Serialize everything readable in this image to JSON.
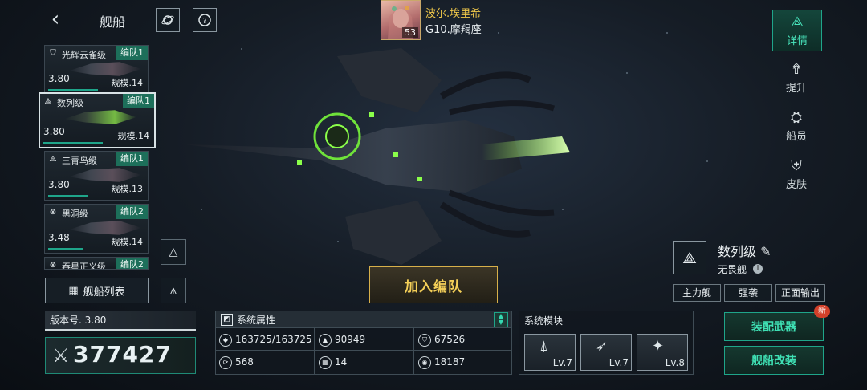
{
  "header": {
    "back_icon": "back-arrow-icon",
    "title": "舰船"
  },
  "commander": {
    "name": "波尔.埃里希",
    "rank": "G10.摩羯座",
    "level": "53"
  },
  "ship_list": [
    {
      "name": "光辉云雀级",
      "fleet": "编队1",
      "version": "3.80",
      "scale": "规模.14",
      "selected": false,
      "progress": 0.62
    },
    {
      "name": "数列级",
      "fleet": "编队1",
      "version": "3.80",
      "scale": "规模.14",
      "selected": true,
      "progress": 0.55
    },
    {
      "name": "三青鸟级",
      "fleet": "编队1",
      "version": "3.80",
      "scale": "规模.13",
      "selected": false,
      "progress": 0.5
    },
    {
      "name": "黑洞级",
      "fleet": "编队2",
      "version": "3.48",
      "scale": "规模.14",
      "selected": false,
      "progress": 0.45
    },
    {
      "name": "吞星正义级",
      "fleet": "编队2",
      "version": "",
      "scale": "",
      "selected": false,
      "progress": 0
    }
  ],
  "ship_list_button": "舰船列表",
  "version_label": "版本号. 3.80",
  "power": "377427",
  "join_button": "加入编队",
  "attributes": {
    "title": "系统属性",
    "values": [
      "163725/163725",
      "90949",
      "67526",
      "568",
      "14",
      "18187"
    ]
  },
  "modules": {
    "title": "系统模块",
    "items": [
      {
        "icon": "turret-icon",
        "level": "Lv.7"
      },
      {
        "icon": "missile-icon",
        "level": "Lv.7"
      },
      {
        "icon": "drone-icon",
        "level": "Lv.8"
      }
    ]
  },
  "actions": {
    "equip": "装配武器",
    "modify": "舰船改装",
    "new_badge": "新"
  },
  "ship_info": {
    "class_name": "数列级",
    "type": "无畏舰",
    "tags": [
      "主力舰",
      "强袭",
      "正面输出"
    ]
  },
  "nav": [
    {
      "label": "详情",
      "icon": "details-icon",
      "active": true
    },
    {
      "label": "提升",
      "icon": "upgrade-icon",
      "active": false
    },
    {
      "label": "船员",
      "icon": "crew-icon",
      "active": false
    },
    {
      "label": "皮肤",
      "icon": "skin-icon",
      "active": false
    }
  ],
  "colors": {
    "accent": "#1fa58a",
    "gold": "#f4cf58",
    "new": "#d2402a"
  }
}
